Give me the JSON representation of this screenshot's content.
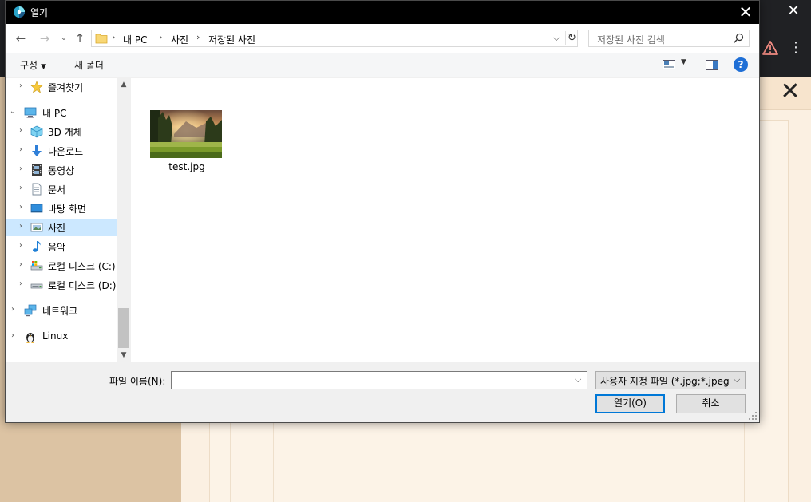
{
  "dialog": {
    "title": "열기",
    "close_glyph": "✕"
  },
  "address": {
    "crumbs": [
      "내 PC",
      "사진",
      "저장된 사진"
    ],
    "separator": "›",
    "search_placeholder": "저장된 사진 검색"
  },
  "toolbar": {
    "organize": "구성",
    "new_folder": "새 폴더",
    "help": "?"
  },
  "nav": {
    "items": [
      {
        "label": "즐겨찾기",
        "icon": "star-icon"
      },
      {
        "label": "내 PC",
        "icon": "computer-icon"
      },
      {
        "label": "3D 개체",
        "icon": "cube-3d-icon"
      },
      {
        "label": "다운로드",
        "icon": "download-arrow-icon"
      },
      {
        "label": "동영상",
        "icon": "video-film-icon"
      },
      {
        "label": "문서",
        "icon": "document-icon"
      },
      {
        "label": "바탕 화면",
        "icon": "desktop-icon"
      },
      {
        "label": "사진",
        "icon": "pictures-icon"
      },
      {
        "label": "음악",
        "icon": "music-note-icon"
      },
      {
        "label": "로컬 디스크 (C:)",
        "icon": "local-disk-c-icon"
      },
      {
        "label": "로컬 디스크 (D:)",
        "icon": "local-disk-d-icon"
      },
      {
        "label": "네트워크",
        "icon": "network-icon"
      },
      {
        "label": "Linux",
        "icon": "linux-penguin-icon"
      }
    ],
    "selected": "사진"
  },
  "files": [
    {
      "name": "test.jpg",
      "icon": "image-thumbnail"
    }
  ],
  "bottom": {
    "filename_label": "파일 이름(N):",
    "filename_value": "",
    "filetype": "사용자 지정 파일 (*.jpg;*.jpeg;*",
    "open_button": "열기(O)",
    "cancel_button": "취소"
  },
  "background": {
    "close_glyph": "✕",
    "kebab_glyph": "⋮",
    "top_close_glyph": "✕"
  },
  "colors": {
    "accent": "#0078d7",
    "selection": "#cce8ff",
    "titlebar": "#000000",
    "help": "#1f6fd6",
    "warning": "#f28b82"
  }
}
